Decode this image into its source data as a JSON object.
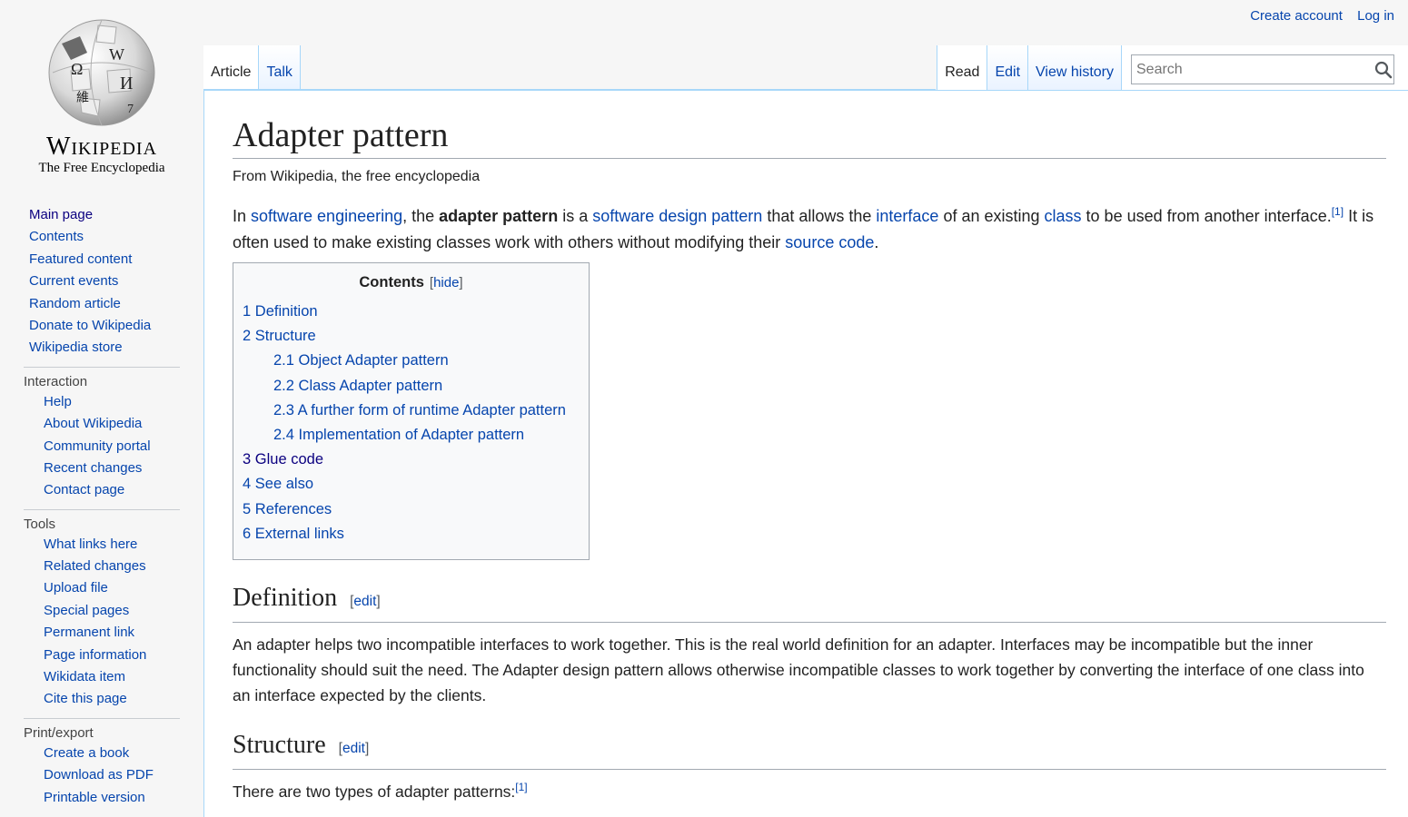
{
  "logo": {
    "wordmark": "Wikipedia",
    "tagline": "The Free Encyclopedia",
    "globe_glyphs": [
      "Ω",
      "W",
      "И",
      "維",
      "7"
    ]
  },
  "personal": {
    "create_account": "Create account",
    "log_in": "Log in"
  },
  "tabs": {
    "article": "Article",
    "talk": "Talk",
    "read": "Read",
    "edit": "Edit",
    "view_history": "View history"
  },
  "search": {
    "placeholder": "Search",
    "icon": "magnifier-icon"
  },
  "sidebar": {
    "navigation": [
      "Main page",
      "Contents",
      "Featured content",
      "Current events",
      "Random article",
      "Donate to Wikipedia",
      "Wikipedia store"
    ],
    "interaction": {
      "heading": "Interaction",
      "items": [
        "Help",
        "About Wikipedia",
        "Community portal",
        "Recent changes",
        "Contact page"
      ]
    },
    "tools": {
      "heading": "Tools",
      "items": [
        "What links here",
        "Related changes",
        "Upload file",
        "Special pages",
        "Permanent link",
        "Page information",
        "Wikidata item",
        "Cite this page"
      ]
    },
    "print": {
      "heading": "Print/export",
      "items": [
        "Create a book",
        "Download as PDF",
        "Printable version"
      ]
    }
  },
  "article": {
    "title": "Adapter pattern",
    "site_sub": "From Wikipedia, the free encyclopedia",
    "intro": {
      "t1": "In ",
      "l1": "software engineering",
      "t2": ", the ",
      "bold": "adapter pattern",
      "t3": " is a ",
      "l2": "software design pattern",
      "t4": " that allows the ",
      "l3": "interface",
      "t5": " of an existing ",
      "l4": "class",
      "t6": " to be used from another interface.",
      "ref": "[1]",
      "t7": " It is often used to make existing classes work with others without modifying their ",
      "l5": "source code",
      "t8": "."
    },
    "toc": {
      "title": "Contents",
      "toggle": "hide",
      "items": [
        {
          "num": "1",
          "text": "Definition"
        },
        {
          "num": "2",
          "text": "Structure"
        },
        {
          "num": "2.1",
          "text": "Object Adapter pattern"
        },
        {
          "num": "2.2",
          "text": "Class Adapter pattern"
        },
        {
          "num": "2.3",
          "text": "A further form of runtime Adapter pattern"
        },
        {
          "num": "2.4",
          "text": "Implementation of Adapter pattern"
        },
        {
          "num": "3",
          "text": "Glue code"
        },
        {
          "num": "4",
          "text": "See also"
        },
        {
          "num": "5",
          "text": "References"
        },
        {
          "num": "6",
          "text": "External links"
        }
      ]
    },
    "definition": {
      "heading": "Definition",
      "edit": "edit",
      "text": "An adapter helps two incompatible interfaces to work together. This is the real world definition for an adapter. Interfaces may be incompatible but the inner functionality should suit the need. The Adapter design pattern allows otherwise incompatible classes to work together by converting the interface of one class into an interface expected by the clients."
    },
    "structure": {
      "heading": "Structure",
      "edit": "edit",
      "text": "There are two types of adapter patterns:",
      "ref": "[1]"
    }
  }
}
